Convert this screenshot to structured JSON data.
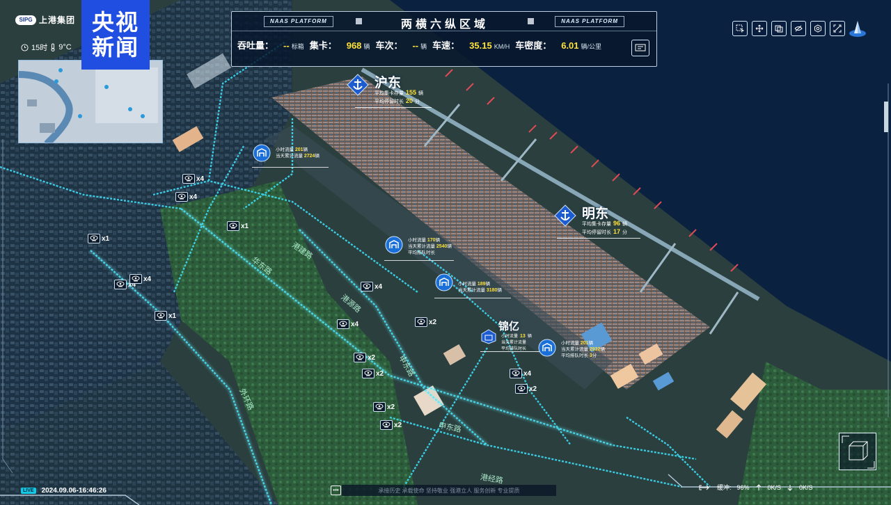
{
  "broadcaster": {
    "line1": "央视",
    "line2": "新闻"
  },
  "brand": {
    "badge": "SIPG",
    "name": "上港集团"
  },
  "weather": {
    "time": "15时",
    "temp": "9°C"
  },
  "hud": {
    "brand_left": "NAAS PLATFORM",
    "brand_right": "NAAS PLATFORM",
    "title": "两横六纵区域",
    "stats": [
      {
        "label": "吞吐量：",
        "value": "--",
        "unit": "标箱"
      },
      {
        "label": "集卡：",
        "value": "968",
        "unit": "辆"
      },
      {
        "label": "车次：",
        "value": "--",
        "unit": "辆"
      },
      {
        "label": "车速：",
        "value": "35.15",
        "unit": "KM/H"
      },
      {
        "label": "车密度：",
        "value": "6.01",
        "unit": "辆/公里"
      }
    ]
  },
  "toolbar": [
    "select-icon",
    "move-icon",
    "layers-icon",
    "hide-icon",
    "settings-icon",
    "fullscreen-icon"
  ],
  "terminals": {
    "hudong": {
      "name": "沪东",
      "row1_label": "平均集卡存量",
      "row1_value": "155",
      "row1_unit": "辆",
      "row2_label": "平均停留时长",
      "row2_value": "20",
      "row2_unit": "分"
    },
    "mingdong": {
      "name": "明东",
      "row1_label": "平均集卡存量",
      "row1_value": "96",
      "row1_unit": "辆",
      "row2_label": "平均停留时长",
      "row2_value": "17",
      "row2_unit": "分"
    },
    "jinyi": {
      "name": "锦亿",
      "row1_label": "小时流量",
      "row1_value": "13",
      "row1_unit": "辆",
      "row2_label": "当天累计流量",
      "row2_value": "",
      "row2_unit": "",
      "row3_label": "平均排队时长",
      "row3_value": "",
      "row3_unit": ""
    }
  },
  "stations": [
    {
      "rows": [
        {
          "label": "小时流量",
          "value": "201",
          "unit": "辆"
        },
        {
          "label": "当天累计流量",
          "value": "2724",
          "unit": "辆"
        }
      ]
    },
    {
      "rows": [
        {
          "label": "小时流量",
          "value": "170",
          "unit": "辆"
        },
        {
          "label": "当天累计流量",
          "value": "2540",
          "unit": "辆"
        },
        {
          "label": "平均排队时长",
          "value": "",
          "unit": ""
        }
      ]
    },
    {
      "rows": [
        {
          "label": "小时流量",
          "value": "189",
          "unit": "辆"
        },
        {
          "label": "当天累计流量",
          "value": "3180",
          "unit": "辆"
        }
      ]
    },
    {
      "rows": [
        {
          "label": "小时流量",
          "value": "201",
          "unit": "辆"
        },
        {
          "label": "当天累计流量",
          "value": "2932",
          "unit": "辆"
        },
        {
          "label": "平均排队时长",
          "value": "3",
          "unit": "分"
        }
      ]
    }
  ],
  "cameras": [
    "x4",
    "x4",
    "x1",
    "x1",
    "x4",
    "x4",
    "x1",
    "x4",
    "x4",
    "x2",
    "x2",
    "x2",
    "x2",
    "x2",
    "x4",
    "x2",
    "x2"
  ],
  "roads": [
    "港建路",
    "华东路",
    "港源路",
    "申东路",
    "港经路",
    "外环路",
    "申东路"
  ],
  "footer": {
    "live": "LIVE",
    "timestamp": "2024.09.06-16:46:26",
    "ticker_btn": "•••",
    "ticker": "承接历史 承载使命 坚持敬业 强港立人 服务创新 专业提质",
    "buffer_label": "缓冲:",
    "buffer_value": "96%",
    "rate1": "0K/S",
    "rate2": "0K/S"
  }
}
